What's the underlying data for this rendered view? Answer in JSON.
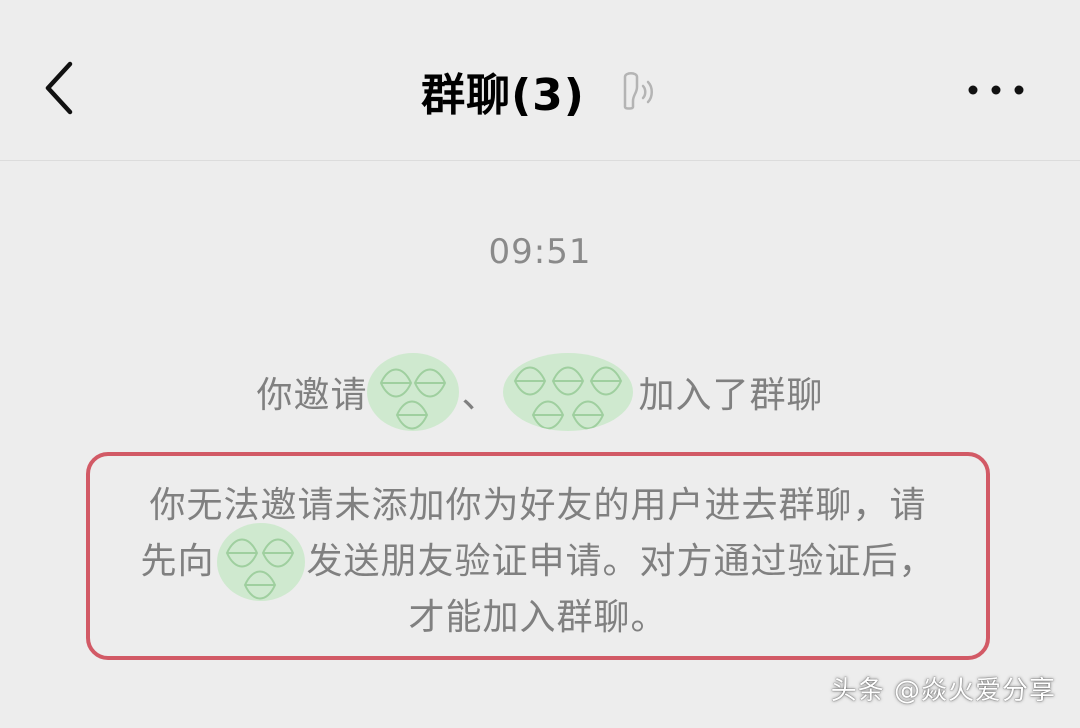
{
  "header": {
    "back_icon": "chevron-left-icon",
    "title": "群聊(3)",
    "earpiece_icon": "earpiece-mode-icon",
    "more_icon": "more-dots-icon"
  },
  "chat": {
    "timestamp": "09:51",
    "system_message": {
      "prefix": "你邀请",
      "separator": "、",
      "suffix": "加入了群聊"
    },
    "notice": {
      "line1": "你无法邀请未添加你为好友的用户进去群聊，请",
      "line2_prefix": "先向",
      "line2_suffix": "发送朋友验证申请。对方通过验证后，",
      "line3": "才能加入群聊。"
    }
  },
  "watermark": "头条 @焱火爱分享",
  "colors": {
    "background": "#ededed",
    "highlight_border": "#d25a66",
    "system_text": "#808080",
    "blur_mask": "#cfe9cf"
  }
}
